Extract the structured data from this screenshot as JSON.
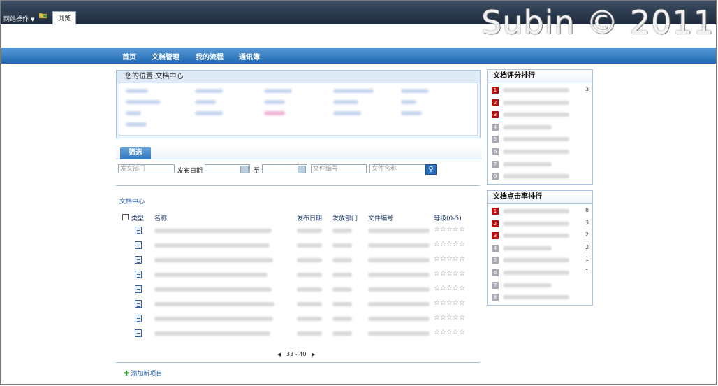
{
  "topbar": {
    "site_actions_label": "网站操作",
    "browse_tab_label": "浏览",
    "watermark": "Subin © 2011"
  },
  "nav": {
    "items": [
      {
        "label": "首页"
      },
      {
        "label": "文档管理"
      },
      {
        "label": "我的流程"
      },
      {
        "label": "通讯簿"
      }
    ]
  },
  "location": {
    "title": "您的位置:文档中心"
  },
  "filter": {
    "tab_label": "筛选",
    "dept_placeholder": "发文部门",
    "date_label": "发布日期",
    "to_label": "至",
    "file_no_placeholder": "文件编号",
    "file_name_placeholder": "文件名称"
  },
  "doc_center": {
    "title": "文档中心",
    "headers": {
      "type": "类型",
      "name": "名称",
      "date": "发布日期",
      "dept": "发放部门",
      "file_no": "文件编号",
      "level": "等级(0-5)"
    },
    "row_count": 8,
    "stars": "☆☆☆☆☆",
    "pager": "33 - 40",
    "add_item": "添加新项目"
  },
  "rank_rating": {
    "title": "文档评分排行",
    "rows": [
      {
        "num": "1",
        "color": "red",
        "value": "3"
      },
      {
        "num": "2",
        "color": "red",
        "value": ""
      },
      {
        "num": "3",
        "color": "red",
        "value": ""
      },
      {
        "num": "4",
        "color": "gray",
        "value": ""
      },
      {
        "num": "5",
        "color": "gray",
        "value": ""
      },
      {
        "num": "6",
        "color": "gray",
        "value": ""
      },
      {
        "num": "7",
        "color": "gray",
        "value": ""
      },
      {
        "num": "8",
        "color": "gray",
        "value": ""
      }
    ]
  },
  "rank_clicks": {
    "title": "文档点击率排行",
    "rows": [
      {
        "num": "1",
        "color": "red",
        "value": "8"
      },
      {
        "num": "2",
        "color": "red",
        "value": "3"
      },
      {
        "num": "3",
        "color": "red",
        "value": "2"
      },
      {
        "num": "4",
        "color": "gray",
        "value": "2"
      },
      {
        "num": "5",
        "color": "gray",
        "value": "1"
      },
      {
        "num": "6",
        "color": "gray",
        "value": "1"
      },
      {
        "num": "7",
        "color": "gray",
        "value": ""
      },
      {
        "num": "8",
        "color": "gray",
        "value": ""
      }
    ]
  },
  "colors": {
    "nav_blue": "#1e69b3",
    "rank_red": "#b31111",
    "rank_gray": "#a9a9b4",
    "link_blue": "#1f5fa8"
  }
}
